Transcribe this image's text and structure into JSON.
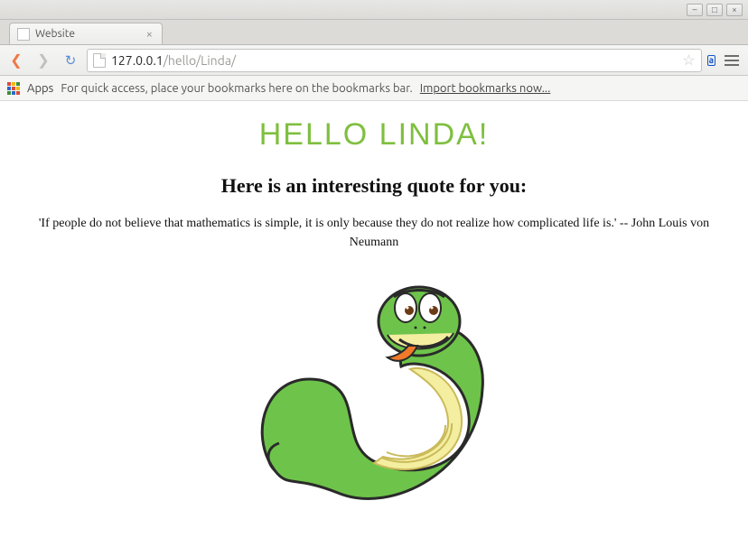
{
  "tab": {
    "title": "Website",
    "close_label": "×"
  },
  "toolbar": {
    "url_host": "127.0.0.1",
    "url_path": "/hello/Linda/"
  },
  "bookmarks_bar": {
    "apps_label": "Apps",
    "hint": "For quick access, place your bookmarks here on the bookmarks bar.",
    "import_label": "Import bookmarks now..."
  },
  "page": {
    "greeting": "Hello Linda!",
    "subheading": "Here is an interesting quote for you:",
    "quote": "'If people do not believe that mathematics is simple, it is only because they do not realize how complicated life is.' -- John Louis von Neumann"
  },
  "window_controls": {
    "min": "–",
    "max": "□",
    "close": "×"
  }
}
